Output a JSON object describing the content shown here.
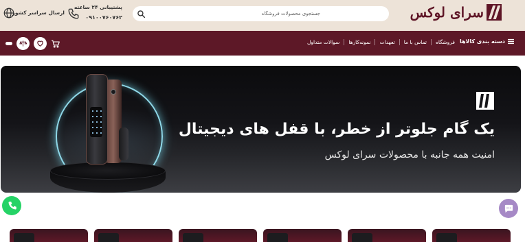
{
  "header": {
    "logo_text": "سرای لوکس",
    "search_placeholder": "جستجوی محصولات فروشگاه",
    "support_title": "پشتیبانی ۲۴ ساعته",
    "support_phone": "۰۹۱۰۰۷۶۰۷۶۲",
    "shipping_label": "ارسال سراسر کشور"
  },
  "nav": {
    "categories_label": "دسته بندی کالاها",
    "items": [
      {
        "label": "فروشگاه"
      },
      {
        "label": "تماس با ما"
      },
      {
        "label": "تعهدات"
      },
      {
        "label": "نمونه‌کارها"
      },
      {
        "label": "سوالات متداول"
      }
    ],
    "icons": [
      "cart-icon",
      "heart-icon",
      "compare-icon"
    ]
  },
  "banner": {
    "headline": "یک گام جلوتر از خطر، با قفل های دیجیتال",
    "subheadline": "امنیت همه جانبه با محصولات سرای لوکس"
  },
  "colors": {
    "brand": "#5d1827",
    "header_bg": "#ede3d8",
    "whatsapp": "#25d366",
    "chat": "#a689c6",
    "ring": "#8fd8e8"
  }
}
